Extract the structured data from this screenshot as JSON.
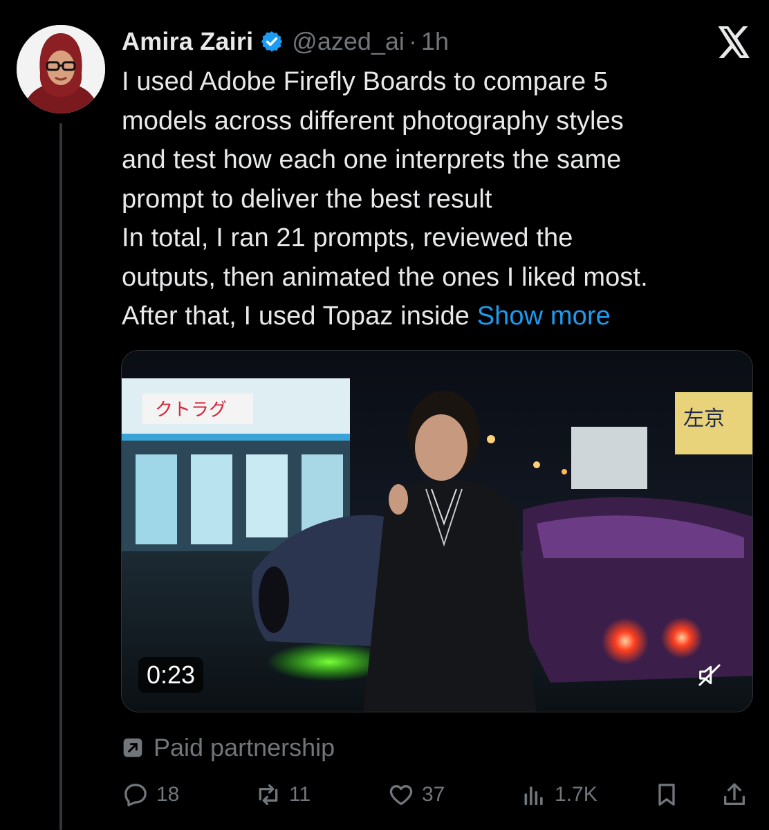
{
  "tweet": {
    "author": {
      "display_name": "Amira Zairi",
      "handle": "@azed_ai",
      "separator": "·",
      "time": "1h"
    },
    "text_lines": [
      "I used Adobe Firefly Boards to compare 5",
      "models across different photography styles",
      "and test how each one interprets the same",
      "prompt to deliver the best result",
      "In total, I ran 21 prompts, reviewed the",
      "outputs, then animated the ones I liked most.",
      "After that, I used Topaz inside"
    ],
    "show_more": "Show more",
    "media": {
      "duration": "0:23",
      "store_sign": "クトラグ",
      "right_sign": "左京"
    },
    "paid_partnership": "Paid partnership",
    "actions": {
      "replies": "18",
      "reposts": "11",
      "likes": "37",
      "views": "1.7K"
    }
  },
  "colors": {
    "background": "#000000",
    "text": "#e7e9ea",
    "muted": "#71767b",
    "link": "#1d9bf0",
    "verified": "#1d9bf0"
  }
}
